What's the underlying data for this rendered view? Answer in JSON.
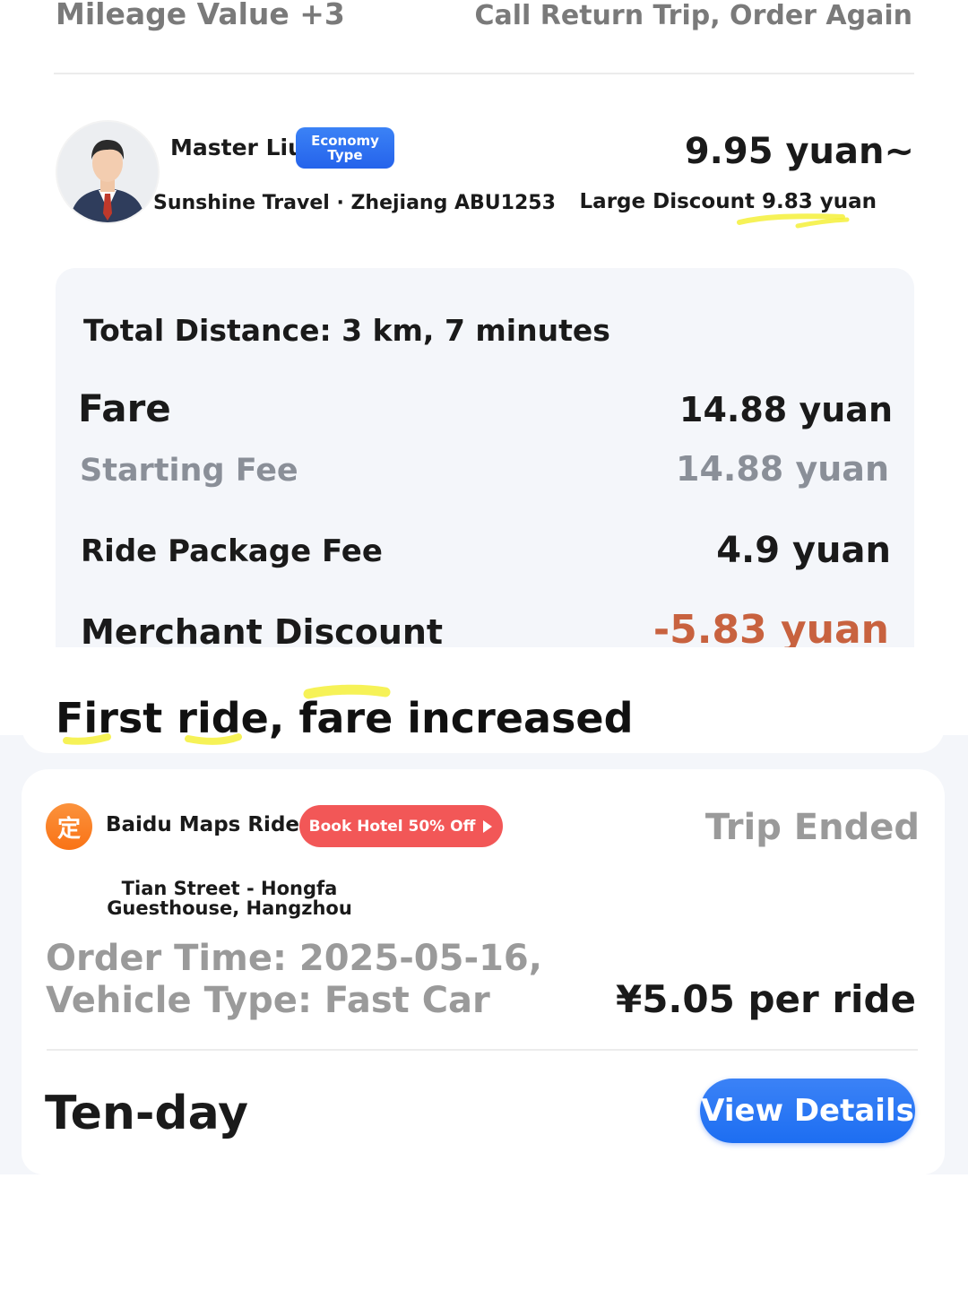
{
  "header": {
    "mileage": "Mileage Value +3",
    "return_trip": "Call Return Trip, Order Again"
  },
  "driver": {
    "name": "Master Liu",
    "car_type_badge": "Economy Type",
    "company_plate": "Sunshine Travel · Zhejiang ABU1253",
    "price_estimate": "9.95 yuan~",
    "discount_note": "Large Discount 9.83 yuan"
  },
  "fare": {
    "total_distance": "Total Distance: 3 km, 7 minutes",
    "rows": [
      {
        "label": "Fare",
        "value": "14.88 yuan"
      },
      {
        "label": "Starting Fee",
        "value": "14.88 yuan"
      },
      {
        "label": "Ride Package Fee",
        "value": "4.9 yuan"
      },
      {
        "label": "Merchant Discount",
        "value": "-5.83 yuan"
      }
    ]
  },
  "banner": {
    "text": "First ride, fare increased"
  },
  "order": {
    "logo_glyph": "定",
    "service_name": "Baidu Maps Ride",
    "promo": "Book Hotel 50% Off",
    "status": "Trip Ended",
    "address": "Tian Street - Hongfa Guesthouse, Hangzhou",
    "order_time": "Order Time: 2025-05-16,",
    "vehicle_type": "Vehicle Type: Fast Car",
    "price_per_ride": "¥5.05 per ride",
    "plan": "Ten-day",
    "details_button": "View Details"
  },
  "colors": {
    "accent_blue": "#2563eb",
    "discount_red": "#c8623f",
    "promo_red": "#f25757",
    "logo_orange": "#f97316",
    "highlighter": "#f5f03a"
  }
}
